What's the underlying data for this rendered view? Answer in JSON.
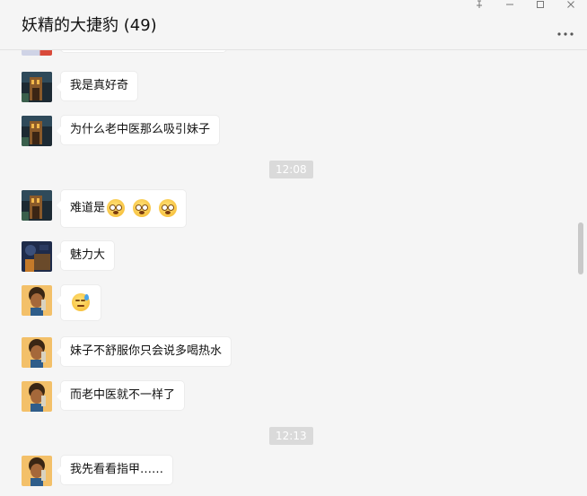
{
  "window": {
    "title": "妖精的大捷豹 (49)",
    "controls": [
      "pin-icon",
      "minimize-icon",
      "maximize-icon",
      "close-icon"
    ],
    "more_icon": "ellipsis-icon"
  },
  "timestamps": [
    "12:08",
    "12:13"
  ],
  "messages": [
    {
      "avatar": "avatar-street",
      "text": "我是真好奇"
    },
    {
      "avatar": "avatar-street",
      "text": "为什么老中医那么吸引妹子"
    },
    {
      "avatar": "avatar-street",
      "text": "难道是",
      "emojis": [
        "flushed-face-emoji",
        "flushed-face-emoji",
        "flushed-face-emoji"
      ]
    },
    {
      "avatar": "avatar-dark",
      "text": "魅力大"
    },
    {
      "avatar": "avatar-cartoon",
      "text": "",
      "emojis": [
        "sweat-face-emoji"
      ]
    },
    {
      "avatar": "avatar-cartoon",
      "text": "妹子不舒服你只会说多喝热水"
    },
    {
      "avatar": "avatar-cartoon",
      "text": "而老中医就不一样了"
    },
    {
      "avatar": "avatar-cartoon",
      "text": "我先看看指甲……"
    }
  ],
  "colors": {
    "background": "#f5f5f5",
    "bubble": "#ffffff",
    "timestamp_bg": "#dadada"
  }
}
